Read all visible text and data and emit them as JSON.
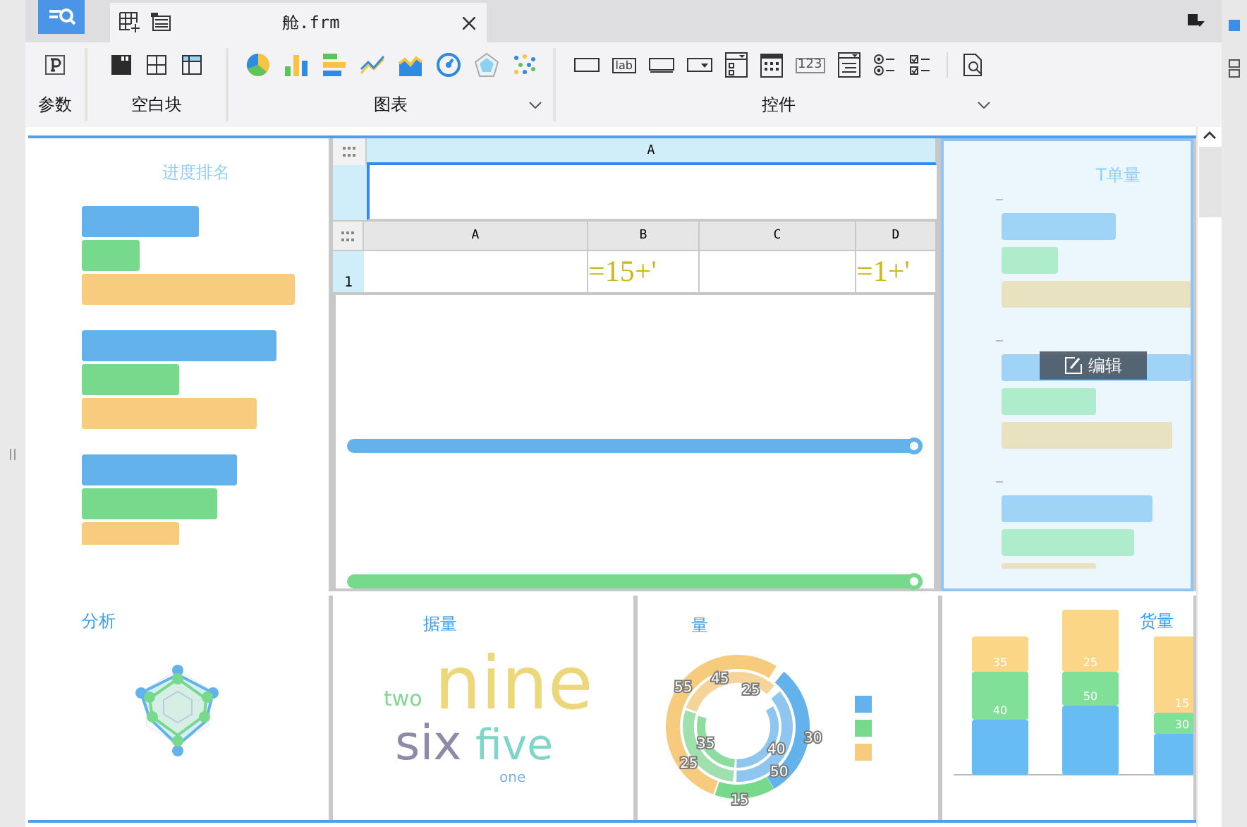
{
  "document_tab": {
    "title": "舱.frm"
  },
  "ribbon": {
    "groups": [
      {
        "kind": "params",
        "label": "参数",
        "tools": [
          {
            "kind": "param"
          }
        ]
      },
      {
        "kind": "blank",
        "label": "空白块",
        "tools": [
          {
            "kind": "block-solid"
          },
          {
            "kind": "block-grid"
          },
          {
            "kind": "block-table"
          }
        ]
      },
      {
        "kind": "charts",
        "label": "图表",
        "tools": [
          {
            "kind": "pie"
          },
          {
            "kind": "bar"
          },
          {
            "kind": "hbar"
          },
          {
            "kind": "line"
          },
          {
            "kind": "area"
          },
          {
            "kind": "gauge"
          },
          {
            "kind": "radar"
          },
          {
            "kind": "scatter"
          }
        ]
      },
      {
        "kind": "controls",
        "label": "控件",
        "tools": [
          {
            "kind": "textbox"
          },
          {
            "kind": "label",
            "text": "lab"
          },
          {
            "kind": "button"
          },
          {
            "kind": "dropdown"
          },
          {
            "kind": "list"
          },
          {
            "kind": "calendar"
          },
          {
            "kind": "number",
            "text": "123"
          },
          {
            "kind": "textarea"
          },
          {
            "kind": "radio"
          },
          {
            "kind": "checkbox"
          },
          {
            "kind": "preview"
          }
        ]
      }
    ]
  },
  "progress_panel": {
    "title": "进度排名"
  },
  "sheet_top": {
    "columns": [
      "A"
    ]
  },
  "sheet": {
    "columns": [
      "A",
      "B",
      "C",
      "D"
    ],
    "rows": [
      {
        "number": "1",
        "cells": [
          null,
          "=15+'",
          null,
          "=1+'"
        ]
      }
    ]
  },
  "sliders": [
    {
      "level": 1,
      "color": "#64b2ec"
    },
    {
      "level": 1,
      "color": "#76d98c"
    }
  ],
  "orders_panel": {
    "title": "T单量",
    "selected": true,
    "edit_label": "编辑"
  },
  "radar_panel": {
    "title": "分析"
  },
  "wordcloud_panel": {
    "title": "据量",
    "words": [
      {
        "text": "two",
        "color": "#7fd68f"
      },
      {
        "text": "nine",
        "color": "#ecd77a"
      },
      {
        "text": "six",
        "color": "#8e8aa8"
      },
      {
        "text": "five",
        "color": "#7fd6c8"
      },
      {
        "text": "one",
        "color": "#7fb0e0"
      }
    ]
  },
  "donut_panel": {
    "title": "量",
    "labels": [
      "55",
      "45",
      "25",
      "35",
      "25",
      "15",
      "40",
      "50",
      "30"
    ],
    "legend": [
      {
        "color": "#64b2ec"
      },
      {
        "color": "#76d98c"
      },
      {
        "color": "#f7cb7e"
      }
    ]
  },
  "stacked_panel": {
    "title": "货量",
    "bars": [
      {
        "labels": [
          "35",
          "40"
        ]
      },
      {
        "labels": [
          "25",
          "50"
        ]
      },
      {
        "labels": [
          "15",
          "30"
        ]
      }
    ]
  }
}
